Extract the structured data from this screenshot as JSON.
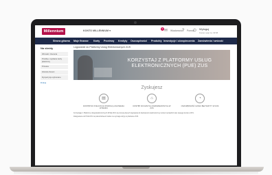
{
  "bank": {
    "logo": "Millennium",
    "account_select": "KONTO MILLENNIUM ▾",
    "messages_label": "Wiadomości",
    "messages_count": "3",
    "help_label": "Pomoc",
    "logout_label": "Wyloguj",
    "logout_sub": "Koniec sesji za: 09:58"
  },
  "nav": {
    "items": [
      "Strona główna",
      "Moje finanse",
      "Karty",
      "Przelewy",
      "Kredyty",
      "Oszczędności",
      "Produkty",
      "Inwestycje i ubezpieczenia",
      "Zamówienia i wnioski"
    ]
  },
  "sidebar": {
    "title": "Na skróty",
    "items": [
      "Wnioski i zlecenia",
      "Prośba o wydanie karty płatniczej",
      "Przelew",
      "Historia zleceń",
      "Dyspozycje wykonane"
    ],
    "link": "Drukuj"
  },
  "content": {
    "breadcrumb": "Logowanie do Platformy Usług Elektronicznych ZUS",
    "hero_title": "KORZYSTAJ Z PLATFORMY USŁUG ELEKTRONICZNYCH (PUE) ZUS",
    "section_title": "Zyskujesz",
    "features": [
      "DOSTĘP DO PUE ZUS ZA POMOCĄ LOGOWANIA W BANKU",
      "DOSTĘP DO DANYCH ZGROMADZONYCH W ZUS",
      "OSZCZĘDNOŚĆ CZASU BEZ WIZYTY W ZUS"
    ],
    "body": [
      "Korzystając z Platformy Usług Elektronicznych (PUE) ZUS za pomocą danych logowania do bankowości elektronicznej możesz sprawdzić stan swojego konta w ZUS.",
      "Zalogowanie do PUE ZUS za pośrednictwem banku nie wymaga wizyty w placówce ZUS."
    ]
  },
  "icons": {
    "feature_1": "document-icon",
    "feature_2": "building-icon",
    "feature_3": "clock-icon"
  },
  "colors": {
    "brand": "#b4124a",
    "nav_bg": "#1e2a4a"
  }
}
